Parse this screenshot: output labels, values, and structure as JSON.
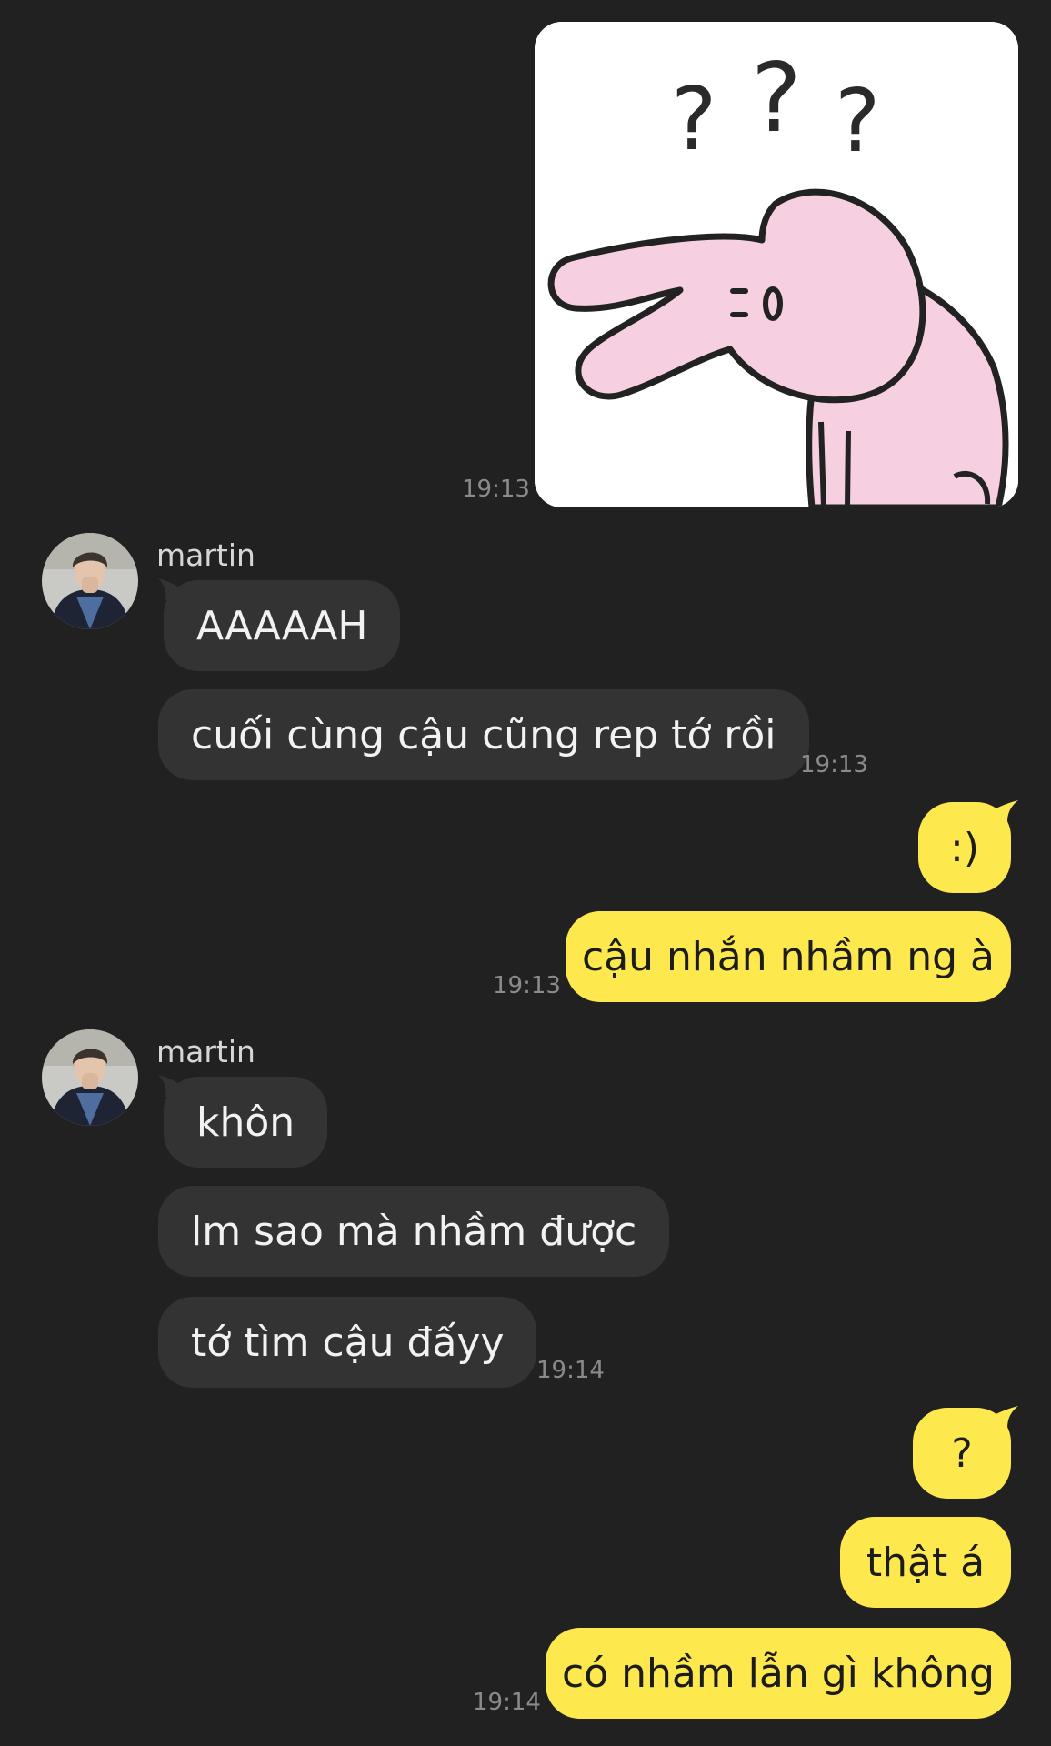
{
  "colors": {
    "background": "#212121",
    "incoming_bubble": "#333333",
    "outgoing_bubble": "#fde84e",
    "timestamp": "#8a8a8a"
  },
  "sticker": {
    "icon": "confused-rabbit-sticker",
    "question_marks": [
      "?",
      "?",
      "?"
    ]
  },
  "messages": {
    "sticker_time": "19:13",
    "group1": {
      "sender": "martin",
      "avatar": "martin-avatar",
      "bubbles": [
        "AAAAAH",
        "cuối cùng cậu cũng rep tớ rồi"
      ],
      "time": "19:13"
    },
    "group2": {
      "bubbles": [
        ":)",
        "cậu nhắn nhầm ng à"
      ],
      "time": "19:13"
    },
    "group3": {
      "sender": "martin",
      "avatar": "martin-avatar",
      "bubbles": [
        "khôn",
        "lm sao mà nhầm được",
        "tớ tìm cậu đấyy"
      ],
      "time": "19:14"
    },
    "group4": {
      "bubbles": [
        "?",
        "thật á",
        "có nhầm lẫn gì không"
      ],
      "time": "19:14"
    }
  }
}
